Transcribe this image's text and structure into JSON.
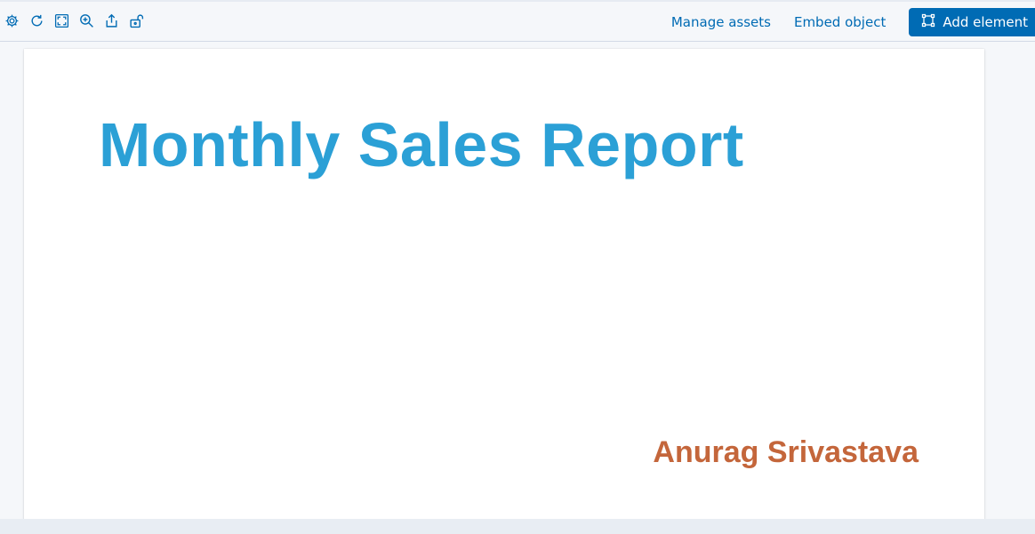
{
  "toolbar": {
    "icons": [
      {
        "name": "settings-icon",
        "label": "Settings"
      },
      {
        "name": "refresh-icon",
        "label": "Refresh"
      },
      {
        "name": "fullscreen-icon",
        "label": "Fullscreen"
      },
      {
        "name": "zoom-in-icon",
        "label": "Zoom"
      },
      {
        "name": "share-icon",
        "label": "Share"
      },
      {
        "name": "unlock-icon",
        "label": "Lock"
      }
    ],
    "manage_assets_label": "Manage assets",
    "embed_object_label": "Embed object",
    "add_element_label": "Add element",
    "accent_color": "#006bb4"
  },
  "page": {
    "title": "Monthly Sales Report",
    "author": "Anurag Srivastava",
    "title_color": "#2ba0d6",
    "author_color": "#c4663b"
  }
}
